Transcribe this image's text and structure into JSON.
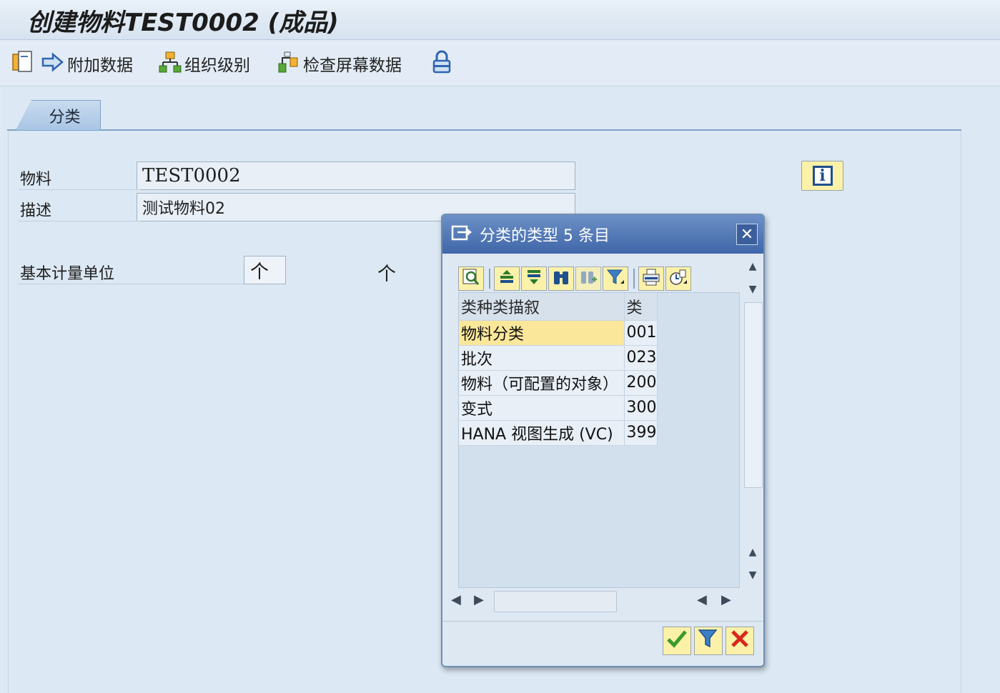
{
  "window": {
    "title": "创建物料TEST0002 (成品)"
  },
  "toolbar": {
    "items": [
      {
        "label": "附加数据",
        "icon": "additional-data-icon"
      },
      {
        "label": "组织级别",
        "icon": "org-levels-icon"
      },
      {
        "label": "检查屏幕数据",
        "icon": "check-screen-icon"
      }
    ]
  },
  "tabs": [
    {
      "label": "分类",
      "active": true
    }
  ],
  "form": {
    "material_label": "物料",
    "material_value": "TEST0002",
    "description_label": "描述",
    "description_value": "测试物料02",
    "base_unit_label": "基本计量单位",
    "base_unit_value": "个",
    "base_unit_text": "个"
  },
  "dialog": {
    "title": "分类的类型 5 条目",
    "columns": [
      "类种类描叙",
      "类"
    ],
    "rows": [
      {
        "desc": "物料分类",
        "code": "001",
        "selected": true
      },
      {
        "desc": "批次",
        "code": "023",
        "selected": false
      },
      {
        "desc": "物料（可配置的对象）",
        "code": "200",
        "selected": false
      },
      {
        "desc": "变式",
        "code": "300",
        "selected": false
      },
      {
        "desc": "HANA 视图生成 (VC)",
        "code": "399",
        "selected": false
      }
    ],
    "toolbar_icons": [
      "search-icon",
      "sort-ascending-icon",
      "sort-descending-icon",
      "find-icon",
      "find-next-icon",
      "filter-icon",
      "print-icon",
      "export-icon"
    ],
    "buttons": [
      "confirm-icon",
      "filter-icon",
      "cancel-icon"
    ]
  },
  "colors": {
    "accent": "#3f66a8",
    "button_yellow": "#fbf1a8",
    "selected_row": "#fbe79a",
    "background": "#dce8f3"
  }
}
